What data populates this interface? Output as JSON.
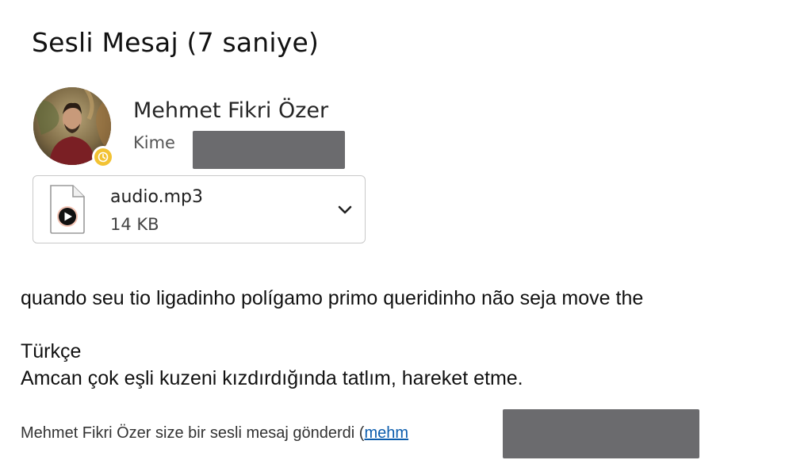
{
  "email": {
    "subject": "Sesli Mesaj (7 saniye)",
    "sender": {
      "name": "Mehmet Fikri Özer",
      "presence_status": "away",
      "presence_color": "#f2c233"
    },
    "recipient": {
      "label": "Kime",
      "value_redacted": true
    },
    "attachment": {
      "file_name": "audio.mp3",
      "file_size": "14 KB",
      "icon": "audio-file-icon",
      "expand_icon": "chevron-down-icon"
    },
    "body": {
      "line1": "quando seu tio ligadinho polígamo primo queridinho não seja move the",
      "language_label": "Türkçe",
      "line2": "Amcan çok eşli kuzeni kızdırdığında tatlım, hareket etme."
    },
    "footer": {
      "text": "Mehmet Fikri Özer size bir sesli mesaj gönderdi (",
      "link_text": "mehm",
      "link_redacted": true,
      "link_color": "#0b5cad"
    }
  }
}
